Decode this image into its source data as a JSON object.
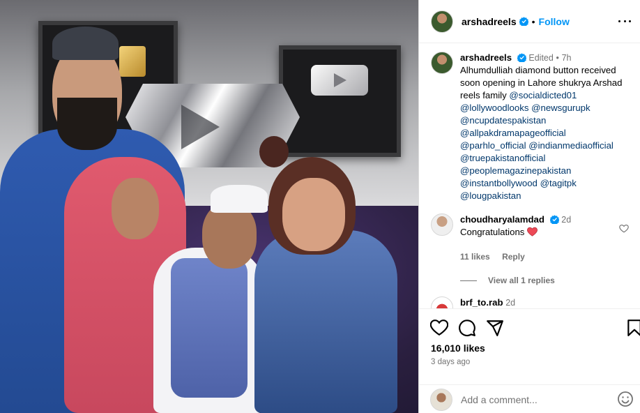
{
  "header": {
    "username": "arshadreels",
    "follow_label": "Follow",
    "dot": "•"
  },
  "caption": {
    "username": "arshadreels",
    "edited": "Edited",
    "dot": "•",
    "time": "7h",
    "text": "Alhumdulliah diamond button received soon opening in Lahore shukrya Arshad reels family ",
    "mentions": [
      "@socialdicted01",
      "@lollywoodlooks",
      "@newsgurupk",
      "@ncupdatespakistan",
      "@allpakdramapageofficial",
      "@parhlo_official",
      "@indianmediaofficial",
      "@truepakistanofficial",
      "@peoplemagazinepakistan",
      "@instantbollywood",
      "@tagitpk",
      "@lougpakistan"
    ]
  },
  "comments": [
    {
      "username": "choudharyalamdad",
      "time": "2d",
      "text": "Congratulations",
      "likes": "11 likes",
      "reply_label": "Reply",
      "view_replies": "View all 1 replies"
    },
    {
      "username": "brf_to.rab",
      "time": "2d"
    }
  ],
  "post": {
    "likes": "16,010 likes",
    "time_ago": "3 days ago"
  },
  "add_comment": {
    "placeholder": "Add a comment..."
  },
  "colors": {
    "accent": "#0095f6",
    "verified": "#0095f6",
    "heart": "#ed4956",
    "muted": "#737373",
    "mention": "#00376b"
  },
  "icons": {
    "like": "heart-icon",
    "comment": "comment-icon",
    "share": "share-icon",
    "save": "bookmark-icon",
    "more": "more-icon",
    "emoji": "emoji-icon"
  }
}
